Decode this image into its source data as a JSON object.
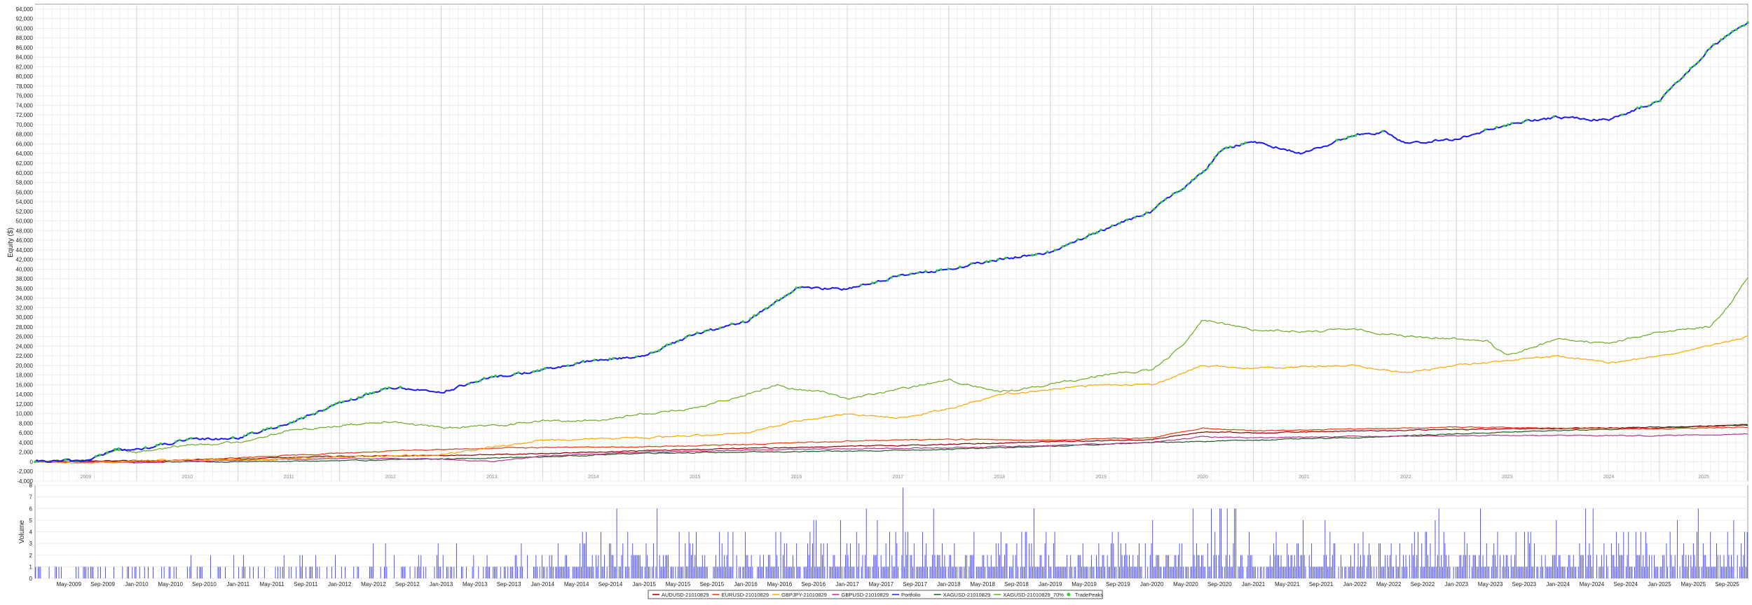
{
  "chart_data": [
    {
      "type": "line",
      "ylabel": "Equity ($)",
      "ylim": [
        -4000,
        95000
      ],
      "yticks": [
        -4000,
        -2000,
        0,
        2000,
        4000,
        6000,
        8000,
        10000,
        12000,
        14000,
        16000,
        18000,
        20000,
        22000,
        24000,
        26000,
        28000,
        30000,
        32000,
        34000,
        36000,
        38000,
        40000,
        42000,
        44000,
        46000,
        48000,
        50000,
        52000,
        54000,
        56000,
        58000,
        60000,
        62000,
        64000,
        66000,
        68000,
        70000,
        72000,
        74000,
        76000,
        78000,
        80000,
        82000,
        84000,
        86000,
        88000,
        90000,
        92000,
        94000
      ],
      "ytick_labels": [
        "-4,000",
        "-2,000",
        "0",
        "2,000",
        "4,000",
        "6,000",
        "8,000",
        "10,000",
        "12,000",
        "14,000",
        "16,000",
        "18,000",
        "20,000",
        "22,000",
        "24,000",
        "26,000",
        "28,000",
        "30,000",
        "32,000",
        "34,000",
        "36,000",
        "38,000",
        "40,000",
        "42,000",
        "44,000",
        "46,000",
        "48,000",
        "50,000",
        "52,000",
        "54,000",
        "56,000",
        "58,000",
        "60,000",
        "62,000",
        "64,000",
        "66,000",
        "68,000",
        "70,000",
        "72,000",
        "74,000",
        "76,000",
        "78,000",
        "80,000",
        "82,000",
        "84,000",
        "86,000",
        "88,000",
        "90,000",
        "92,000",
        "94,000"
      ],
      "xlim": [
        2009.0,
        2025.87
      ],
      "year_labels": [
        "2009",
        "2010",
        "2011",
        "2012",
        "2013",
        "2014",
        "2015",
        "2016",
        "2017",
        "2018",
        "2019",
        "2020",
        "2021",
        "2022",
        "2023",
        "2024",
        "2025"
      ],
      "grid": true,
      "series": [
        {
          "name": "AUDUSD-21010829",
          "color": "#8b0000",
          "x": [
            2009.0,
            2010,
            2011,
            2012,
            2013,
            2014,
            2015,
            2016,
            2017,
            2018,
            2019,
            2020,
            2020.5,
            2021,
            2022,
            2023,
            2024,
            2025,
            2025.87
          ],
          "y": [
            0,
            200,
            600,
            1200,
            1300,
            1700,
            2300,
            2800,
            3200,
            3600,
            4200,
            4600,
            6200,
            6000,
            6400,
            6700,
            6900,
            7200,
            7600
          ]
        },
        {
          "name": "EURUSD-21010829",
          "color": "#e8380d",
          "x": [
            2009.0,
            2010,
            2011,
            2012,
            2013,
            2014,
            2015,
            2016,
            2017,
            2018,
            2019,
            2020,
            2020.5,
            2021,
            2022,
            2023,
            2024,
            2025,
            2025.87
          ],
          "y": [
            0,
            0,
            800,
            1800,
            2600,
            3000,
            3100,
            3600,
            4300,
            4700,
            4500,
            5000,
            7000,
            6400,
            6800,
            7200,
            7000,
            6800,
            7200
          ]
        },
        {
          "name": "GBPJPY-21010829",
          "color": "#ffa500",
          "x": [
            2009.0,
            2009.5,
            2010,
            2011,
            2012,
            2013,
            2014,
            2015,
            2016,
            2016.5,
            2017,
            2017.5,
            2018,
            2018.5,
            2019,
            2019.5,
            2020,
            2020.5,
            2021,
            2022,
            2022.5,
            2023,
            2023.5,
            2024,
            2024.5,
            2025,
            2025.5,
            2025.87
          ],
          "y": [
            0,
            -300,
            200,
            400,
            1000,
            1500,
            4500,
            5000,
            6000,
            8500,
            10000,
            9000,
            11000,
            14000,
            15000,
            16000,
            16000,
            20000,
            19500,
            20000,
            18500,
            20000,
            21000,
            22000,
            20500,
            22000,
            24000,
            26000
          ]
        },
        {
          "name": "GBPUSD-21010829",
          "color": "#b5338a",
          "x": [
            2009.0,
            2010,
            2011,
            2012,
            2013,
            2013.5,
            2014,
            2015,
            2016,
            2017,
            2018,
            2019,
            2020,
            2020.5,
            2021,
            2022,
            2023,
            2024,
            2025,
            2025.87
          ],
          "y": [
            0,
            -200,
            300,
            700,
            600,
            0,
            1200,
            2000,
            2400,
            2700,
            2900,
            3400,
            4000,
            5200,
            5000,
            5300,
            5400,
            5500,
            5400,
            5800
          ]
        },
        {
          "name": "Portfolio",
          "color": "#1a1aff",
          "x": [
            2009.0,
            2009.5,
            2009.8,
            2010,
            2010.5,
            2011,
            2011.5,
            2012,
            2012.5,
            2013,
            2013.5,
            2014,
            2014.5,
            2015,
            2015.5,
            2016,
            2016.5,
            2017,
            2017.5,
            2018,
            2018.5,
            2019,
            2019.5,
            2020,
            2020.5,
            2020.7,
            2021,
            2021.5,
            2022,
            2022.3,
            2022.5,
            2023,
            2023.5,
            2024,
            2024.5,
            2025,
            2025.5,
            2025.87
          ],
          "y": [
            0,
            300,
            2500,
            2500,
            4500,
            5000,
            8000,
            12000,
            15500,
            14500,
            17500,
            19000,
            21000,
            22000,
            26500,
            29000,
            36000,
            36000,
            38500,
            40000,
            42000,
            43500,
            48000,
            52000,
            60000,
            65000,
            66500,
            64000,
            68000,
            68500,
            66000,
            67000,
            70000,
            71500,
            71000,
            75000,
            86000,
            91000
          ]
        },
        {
          "name": "XAGUSD-21010829",
          "color": "#1f5c1f",
          "x": [
            2009.0,
            2010,
            2011,
            2012,
            2013,
            2014,
            2015,
            2016,
            2017,
            2018,
            2019,
            2020,
            2021,
            2022,
            2023,
            2024,
            2025,
            2025.87
          ],
          "y": [
            0,
            0,
            0,
            200,
            600,
            1000,
            1800,
            2000,
            2200,
            2600,
            3200,
            4000,
            4500,
            5000,
            5800,
            6500,
            7000,
            7800
          ]
        },
        {
          "name": "XAGUSD-21010829_70%",
          "color": "#6aaa24",
          "x": [
            2009.0,
            2009.5,
            2009.8,
            2010,
            2010.5,
            2011,
            2011.5,
            2012,
            2012.5,
            2013,
            2013.5,
            2014,
            2014.5,
            2015,
            2015.5,
            2016,
            2016.3,
            2016.5,
            2016.8,
            2017,
            2017.5,
            2018,
            2018.3,
            2018.5,
            2019,
            2019.5,
            2020,
            2020.3,
            2020.5,
            2021,
            2021.5,
            2022,
            2022.5,
            2023,
            2023.3,
            2023.5,
            2024,
            2024.5,
            2025,
            2025.5,
            2025.7,
            2025.87
          ],
          "y": [
            0,
            300,
            2500,
            2000,
            3500,
            4000,
            6500,
            7500,
            8500,
            7000,
            7500,
            8500,
            8500,
            10000,
            11000,
            14000,
            16000,
            15000,
            14500,
            13000,
            15000,
            17000,
            15500,
            14500,
            16000,
            18000,
            19000,
            24000,
            29500,
            27500,
            27000,
            27500,
            26000,
            25500,
            25000,
            22000,
            25500,
            24500,
            27000,
            28000,
            33000,
            38000
          ]
        }
      ],
      "marker_series": {
        "name": "TradePeaks",
        "color": "#2ecc40",
        "follows": "Portfolio"
      }
    },
    {
      "type": "bar",
      "ylabel": "Volume",
      "ylim": [
        0,
        8
      ],
      "yticks": [
        0,
        1,
        2,
        3,
        4,
        5,
        6,
        7,
        8
      ],
      "ytick_labels": [
        "0",
        "1",
        "2",
        "3",
        "4",
        "5",
        "6",
        "7",
        "8"
      ],
      "bar_color": "#2a2aff",
      "x_labels": [
        "May-2009",
        "Sep-2009",
        "Jan-2010",
        "May-2010",
        "Sep-2010",
        "Jan-2011",
        "May-2011",
        "Sep-2011",
        "Jan-2012",
        "May-2012",
        "Sep-2012",
        "Jan-2013",
        "May-2013",
        "Sep-2013",
        "Jan-2014",
        "May-2014",
        "Sep-2014",
        "Jan-2015",
        "May-2015",
        "Sep-2015",
        "Jan-2016",
        "May-2016",
        "Sep-2016",
        "Jan-2017",
        "May-2017",
        "Sep-2017",
        "Jan-2018",
        "May-2018",
        "Sep-2018",
        "Jan-2019",
        "May-2019",
        "Sep-2019",
        "Jan-2020",
        "May-2020",
        "Sep-2020",
        "Jan-2021",
        "May-2021",
        "Sep-2021",
        "Jan-2022",
        "May-2022",
        "Sep-2022",
        "Jan-2023",
        "May-2023",
        "Sep-2023",
        "Jan-2024",
        "May-2024",
        "Sep-2024",
        "Jan-2025",
        "May-2025",
        "Sep-2025"
      ],
      "max_value": 7.8,
      "typical_range": [
        0,
        3
      ]
    }
  ],
  "legend": {
    "placement": "bottom-center",
    "entries": [
      {
        "label": "AUDUSD-21010829",
        "color": "#8b0000",
        "kind": "line"
      },
      {
        "label": "EURUSD-21010829",
        "color": "#e8380d",
        "kind": "line"
      },
      {
        "label": "GBPJPY-21010829",
        "color": "#ffa500",
        "kind": "line"
      },
      {
        "label": "GBPUSD-21010829",
        "color": "#b5338a",
        "kind": "line"
      },
      {
        "label": "Portfolio",
        "color": "#1a1aff",
        "kind": "line"
      },
      {
        "label": "XAGUSD-21010829",
        "color": "#1f5c1f",
        "kind": "line"
      },
      {
        "label": "XAGUSD-21010829_70%",
        "color": "#6aaa24",
        "kind": "line"
      },
      {
        "label": "TradePeaks",
        "color": "#2ecc40",
        "kind": "dot"
      }
    ]
  }
}
